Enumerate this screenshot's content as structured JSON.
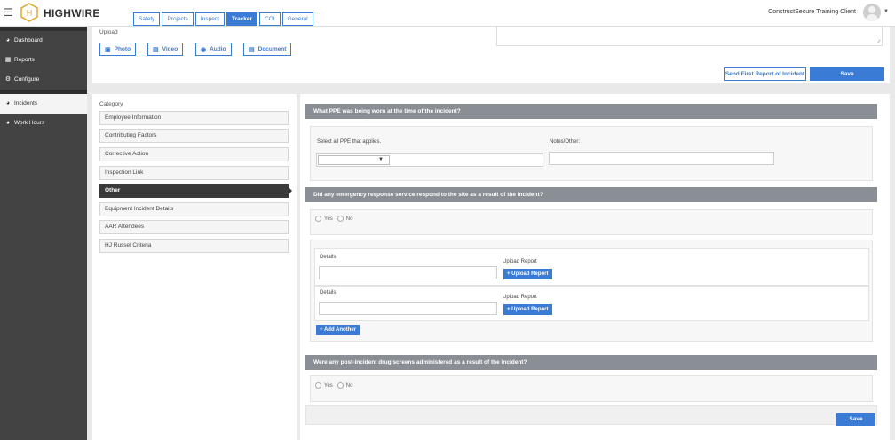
{
  "header": {
    "logo_text": "HIGHWIRE",
    "tabs": [
      {
        "label": "Safety",
        "active": false
      },
      {
        "label": "Projects",
        "active": false
      },
      {
        "label": "Inspect",
        "active": false
      },
      {
        "label": "Tracker",
        "active": true
      },
      {
        "label": "COI",
        "active": false
      },
      {
        "label": "General",
        "active": false
      }
    ],
    "client_name": "ConstructSecure Training Client",
    "icons": {
      "menu": "hamburger-icon",
      "logo": "highwire-hexagon-logo",
      "avatar": "user-avatar-icon",
      "dropdown": "caret-down-icon"
    }
  },
  "sidebar": {
    "items": [
      {
        "label": "Dashboard",
        "icon": "dashboard-gauge-icon",
        "active": false
      },
      {
        "label": "Reports",
        "icon": "document-icon",
        "active": false
      },
      {
        "label": "Configure",
        "icon": "gear-icon",
        "active": false
      },
      {
        "label": "Incidents",
        "icon": "gauge-icon",
        "active": true
      },
      {
        "label": "Work Hours",
        "icon": "gauge-icon",
        "active": false
      }
    ]
  },
  "upload": {
    "label": "Upload",
    "buttons": [
      {
        "label": "Photo",
        "icon": "photo-icon"
      },
      {
        "label": "Video",
        "icon": "video-film-icon"
      },
      {
        "label": "Audio",
        "icon": "audio-icon"
      },
      {
        "label": "Document",
        "icon": "document-icon"
      }
    ],
    "send_first_report_label": "Send First Report of Incident",
    "save_label": "Save"
  },
  "category": {
    "label": "Category",
    "items": [
      {
        "label": "Employee Information",
        "active": false
      },
      {
        "label": "Contributing Factors",
        "active": false
      },
      {
        "label": "Corrective Action",
        "active": false
      },
      {
        "label": "Inspection Link",
        "active": false
      },
      {
        "label": "Other",
        "active": true
      },
      {
        "label": "Equipment Incident Details",
        "active": false
      },
      {
        "label": "AAR Attendees",
        "active": false
      },
      {
        "label": "HJ Russel Criteria",
        "active": false
      }
    ]
  },
  "ppe": {
    "question": "What PPE was being worn at the time of the incident?",
    "select_label": "Select all PPE that applies.",
    "select_value": "",
    "notes_label": "Notes/Other:",
    "notes_value": ""
  },
  "emergency": {
    "question": "Did any emergency response service respond to the site as a result of the incident?",
    "yes_label": "Yes",
    "no_label": "No",
    "rows": [
      {
        "details_label": "Details",
        "details_value": "",
        "upload_label": "Upload Report",
        "upload_button": "+ Upload Report"
      },
      {
        "details_label": "Details",
        "details_value": "",
        "upload_label": "Upload Report",
        "upload_button": "+ Upload Report"
      }
    ],
    "add_another_label": "+ Add Another"
  },
  "drug_screens": {
    "question": "Were any post-incident drug screens administered as a result of the incident?",
    "yes_label": "Yes",
    "no_label": "No"
  },
  "footer": {
    "save_label": "Save"
  },
  "colors": {
    "accent": "#3a7bd5",
    "sidebar": "#434343",
    "section_header": "#8a8f96",
    "active_category": "#3a3a3a"
  }
}
